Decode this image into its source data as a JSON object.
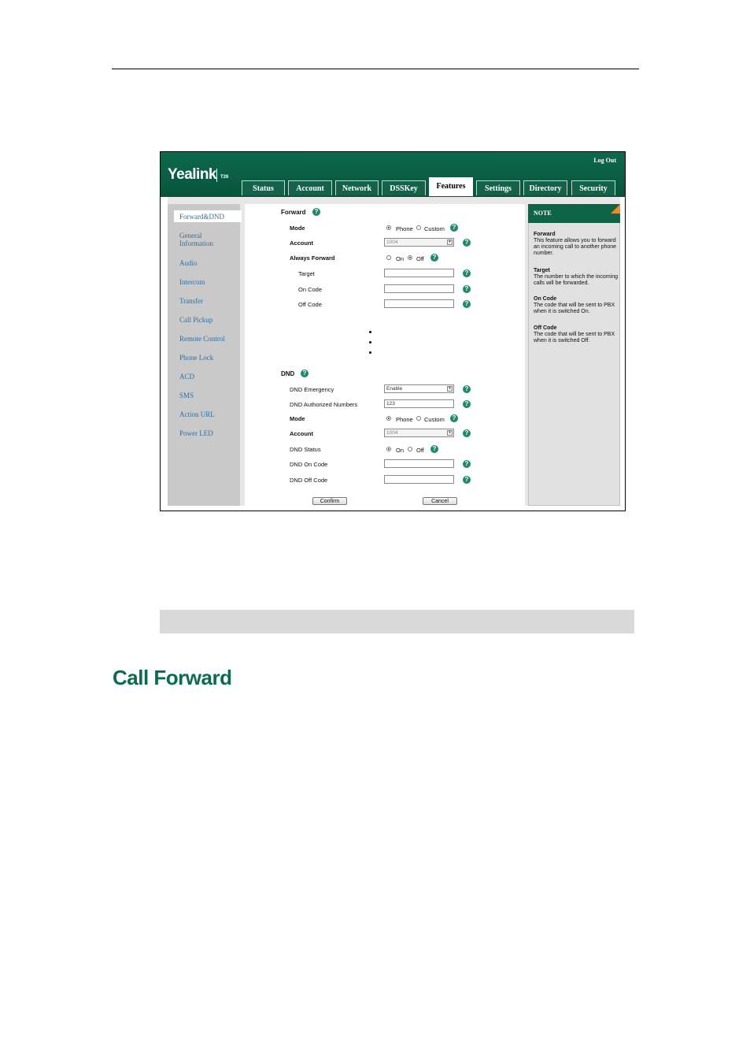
{
  "header": {
    "logo": "Yealink",
    "model": "T26",
    "logout": "Log Out"
  },
  "tabs": [
    {
      "label": "Status"
    },
    {
      "label": "Account"
    },
    {
      "label": "Network"
    },
    {
      "label": "DSSKey"
    },
    {
      "label": "Features",
      "active": true
    },
    {
      "label": "Settings"
    },
    {
      "label": "Directory"
    },
    {
      "label": "Security"
    }
  ],
  "sidebar": {
    "items": [
      {
        "label": "Forward&DND",
        "active": true
      },
      {
        "label": "General Information"
      },
      {
        "label": "Audio"
      },
      {
        "label": "Intercom"
      },
      {
        "label": "Transfer"
      },
      {
        "label": "Call Pickup"
      },
      {
        "label": "Remote Control"
      },
      {
        "label": "Phone Lock"
      },
      {
        "label": "ACD"
      },
      {
        "label": "SMS"
      },
      {
        "label": "Action URL"
      },
      {
        "label": "Power LED"
      }
    ]
  },
  "forward": {
    "title": "Forward",
    "mode_label": "Mode",
    "mode_phone": "Phone",
    "mode_custom": "Custom",
    "account_label": "Account",
    "account_value": "1004",
    "always_label": "Always Forward",
    "on": "On",
    "off": "Off",
    "target_label": "Target",
    "on_code_label": "On Code",
    "off_code_label": "Off Code"
  },
  "dnd": {
    "title": "DND",
    "emergency_label": "DND Emergency",
    "emergency_value": "Enable",
    "authorized_label": "DND Authorized Numbers",
    "authorized_value": "123",
    "mode_label": "Mode",
    "mode_phone": "Phone",
    "mode_custom": "Custom",
    "account_label": "Account",
    "account_value": "1004",
    "status_label": "DND Status",
    "on": "On",
    "off": "Off",
    "on_code_label": "DND On Code",
    "off_code_label": "DND Off Code"
  },
  "buttons": {
    "confirm": "Confirm",
    "cancel": "Cancel"
  },
  "note": {
    "title": "NOTE",
    "forward_title": "Forward",
    "forward_text": "This feature allows you to forward an incoming call to another phone number.",
    "target_title": "Target",
    "target_text": "The number to which the incoming calls will be forwarded.",
    "on_code_title": "On Code",
    "on_code_text": "The code that will be sent to PBX when it is switched On.",
    "off_code_title": "Off Code",
    "off_code_text": "The code that will be sent to PBX when it is switched Off."
  },
  "doc": {
    "heading": "Call Forward"
  },
  "colors": {
    "brand_green": "#0d6a4d",
    "heading_green": "#0b6b4e",
    "link_blue": "#2f6fa0",
    "note_accent": "#f08c1e"
  }
}
